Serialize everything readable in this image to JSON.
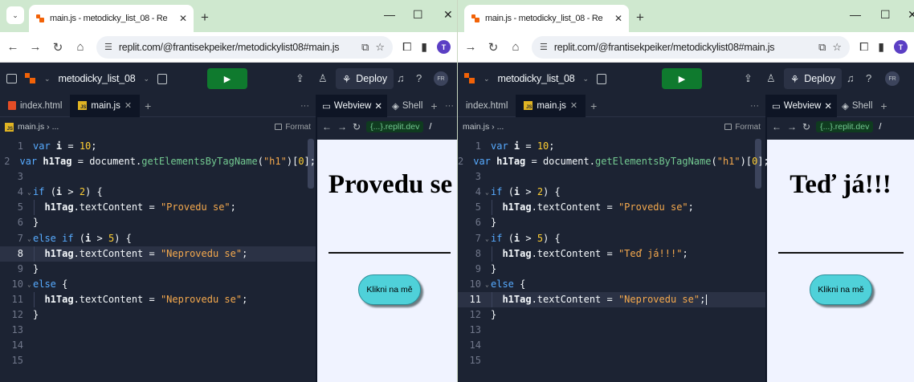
{
  "windows": [
    {
      "browser": {
        "tab_title": "main.js - metodicky_list_08 - Re",
        "url": "replit.com/@frantisekpeiker/metodickylist08#main.js",
        "profile_initial": "T"
      },
      "replit": {
        "project_name": "metodicky_list_08",
        "deploy_label": "Deploy",
        "avatar_initials": "FR",
        "editor_tabs": [
          "index.html",
          "main.js"
        ],
        "breadcrumb": "main.js › ...",
        "format_label": "Format",
        "webview_tab": "Webview",
        "shell_tab": "Shell",
        "dev_url": "{...}.replit.dev",
        "path": "/"
      },
      "code": {
        "line_numbers": [
          "1",
          "2",
          "3",
          "4",
          "5",
          "6",
          "7",
          "8",
          "9",
          "10",
          "11",
          "12",
          "13",
          "14",
          "15"
        ],
        "lines": [
          [
            [
              "kw",
              "var "
            ],
            [
              "id",
              "i"
            ],
            [
              "op",
              " = "
            ],
            [
              "num",
              "10"
            ],
            [
              "op",
              ";"
            ]
          ],
          [
            [
              "kw",
              "var "
            ],
            [
              "id",
              "h1Tag"
            ],
            [
              "op",
              " = "
            ],
            [
              "op",
              "document."
            ],
            [
              "fn",
              "getElementsByTagName"
            ],
            [
              "op",
              "("
            ],
            [
              "str",
              "\"h1\""
            ],
            [
              "op",
              ")["
            ],
            [
              "num",
              "0"
            ],
            [
              "op",
              "];"
            ]
          ],
          [],
          [
            [
              "kw",
              "if "
            ],
            [
              "op",
              "("
            ],
            [
              "id",
              "i"
            ],
            [
              "op",
              " > "
            ],
            [
              "num",
              "2"
            ],
            [
              "op",
              ") {"
            ]
          ],
          [
            [
              "op",
              "  "
            ],
            [
              "id",
              "h1Tag"
            ],
            [
              "op",
              ".textContent = "
            ],
            [
              "str",
              "\"Provedu se\""
            ],
            [
              "op",
              ";"
            ]
          ],
          [
            [
              "op",
              "}"
            ]
          ],
          [
            [
              "kw",
              "else if "
            ],
            [
              "op",
              "("
            ],
            [
              "id",
              "i"
            ],
            [
              "op",
              " > "
            ],
            [
              "num",
              "5"
            ],
            [
              "op",
              ") {"
            ]
          ],
          [
            [
              "op",
              "  "
            ],
            [
              "id",
              "h1Tag"
            ],
            [
              "op",
              ".textContent = "
            ],
            [
              "str",
              "\"Neprovedu se\""
            ],
            [
              "op",
              ";"
            ]
          ],
          [
            [
              "op",
              "}"
            ]
          ],
          [
            [
              "kw",
              "else "
            ],
            [
              "op",
              "{"
            ]
          ],
          [
            [
              "op",
              "  "
            ],
            [
              "id",
              "h1Tag"
            ],
            [
              "op",
              ".textContent = "
            ],
            [
              "str",
              "\"Neprovedu se\""
            ],
            [
              "op",
              ";"
            ]
          ],
          [
            [
              "op",
              "}"
            ]
          ],
          [],
          [],
          []
        ]
      },
      "preview": {
        "heading": "Provedu se",
        "button_label": "Klikni na mě"
      }
    },
    {
      "browser": {
        "tab_title": "main.js - metodicky_list_08 - Re",
        "url": "replit.com/@frantisekpeiker/metodickylist08#main.js",
        "profile_initial": "T"
      },
      "replit": {
        "project_name": "metodicky_list_08",
        "deploy_label": "Deploy",
        "avatar_initials": "FR",
        "editor_tabs": [
          "index.html",
          "main.js"
        ],
        "breadcrumb": "main.js › ...",
        "format_label": "Format",
        "webview_tab": "Webview",
        "shell_tab": "Shell",
        "dev_url": "{...}.replit.dev",
        "path": "/"
      },
      "code": {
        "line_numbers": [
          "1",
          "2",
          "3",
          "4",
          "5",
          "6",
          "7",
          "8",
          "9",
          "10",
          "11",
          "12",
          "13",
          "14",
          "15"
        ],
        "lines": [
          [
            [
              "kw",
              "var "
            ],
            [
              "id",
              "i"
            ],
            [
              "op",
              " = "
            ],
            [
              "num",
              "10"
            ],
            [
              "op",
              ";"
            ]
          ],
          [
            [
              "kw",
              "var "
            ],
            [
              "id",
              "h1Tag"
            ],
            [
              "op",
              " = "
            ],
            [
              "op",
              "document."
            ],
            [
              "fn",
              "getElementsByTagName"
            ],
            [
              "op",
              "("
            ],
            [
              "str",
              "\"h1\""
            ],
            [
              "op",
              ")["
            ],
            [
              "num",
              "0"
            ],
            [
              "op",
              "];"
            ]
          ],
          [],
          [
            [
              "kw",
              "if "
            ],
            [
              "op",
              "("
            ],
            [
              "id",
              "i"
            ],
            [
              "op",
              " > "
            ],
            [
              "num",
              "2"
            ],
            [
              "op",
              ") {"
            ]
          ],
          [
            [
              "op",
              "  "
            ],
            [
              "id",
              "h1Tag"
            ],
            [
              "op",
              ".textContent = "
            ],
            [
              "str",
              "\"Provedu se\""
            ],
            [
              "op",
              ";"
            ]
          ],
          [
            [
              "op",
              "}"
            ]
          ],
          [
            [
              "kw",
              "if "
            ],
            [
              "op",
              "("
            ],
            [
              "id",
              "i"
            ],
            [
              "op",
              " > "
            ],
            [
              "num",
              "5"
            ],
            [
              "op",
              ") {"
            ]
          ],
          [
            [
              "op",
              "  "
            ],
            [
              "id",
              "h1Tag"
            ],
            [
              "op",
              ".textContent = "
            ],
            [
              "str",
              "\"Teď já!!!\""
            ],
            [
              "op",
              ";"
            ]
          ],
          [
            [
              "op",
              "}"
            ]
          ],
          [
            [
              "kw",
              "else "
            ],
            [
              "op",
              "{"
            ]
          ],
          [
            [
              "op",
              "  "
            ],
            [
              "id",
              "h1Tag"
            ],
            [
              "op",
              ".textContent = "
            ],
            [
              "str",
              "\"Neprovedu se\""
            ],
            [
              "op",
              ";"
            ]
          ],
          [
            [
              "op",
              "}"
            ]
          ],
          [],
          [],
          []
        ]
      },
      "preview": {
        "heading": "Teď já!!!",
        "button_label": "Klikni na mě"
      }
    }
  ]
}
